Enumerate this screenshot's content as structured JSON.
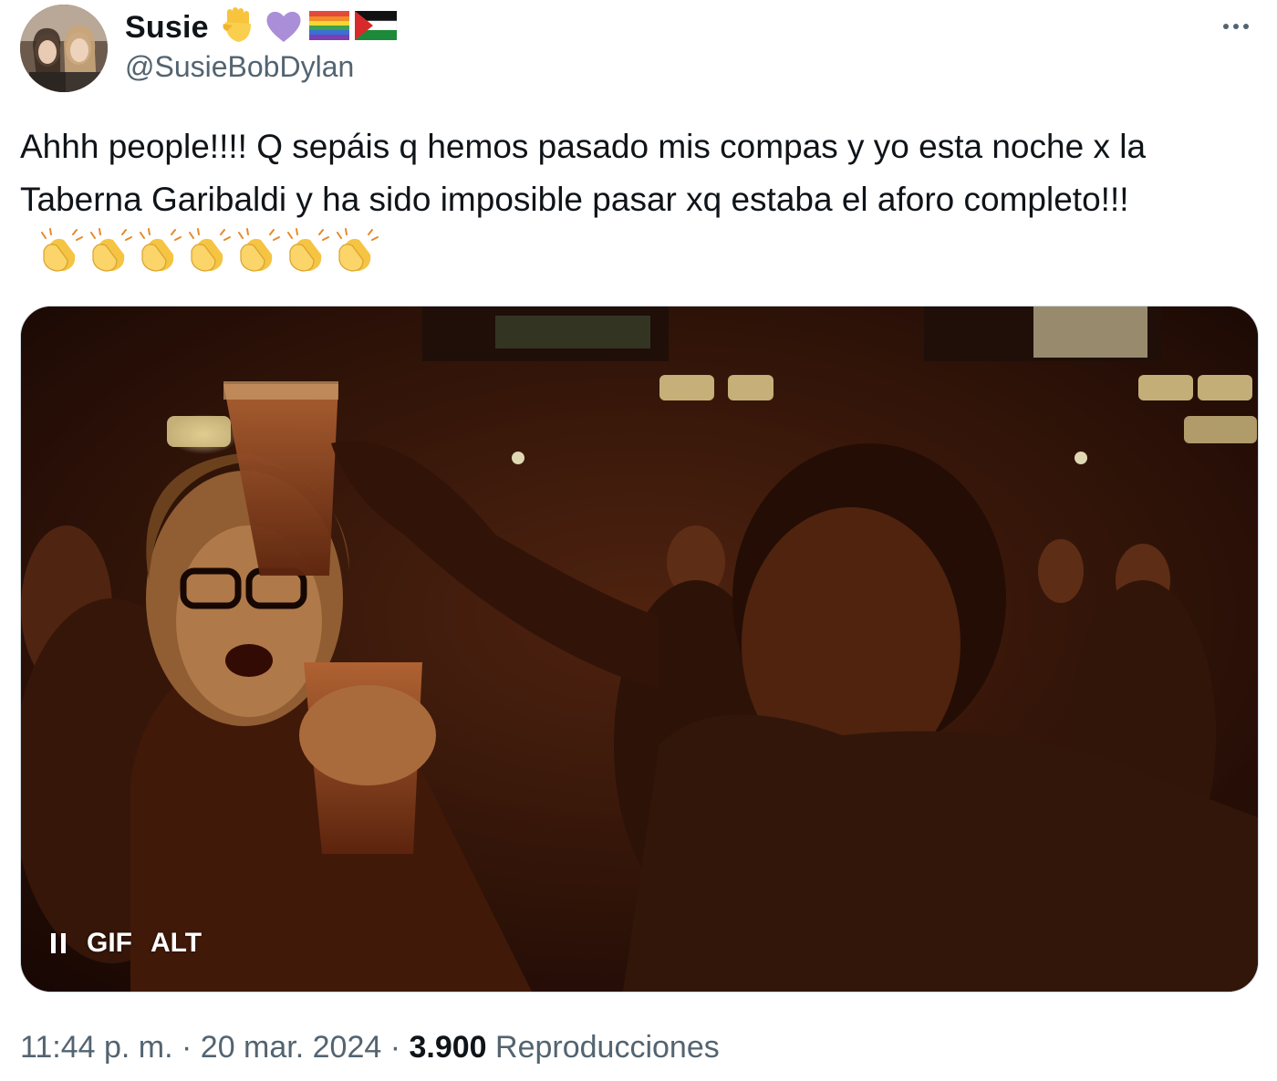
{
  "author": {
    "display_name": "Susie",
    "handle": "@SusieBobDylan",
    "name_emojis": [
      "raised-fist",
      "purple-heart",
      "rainbow-flag",
      "palestine-flag"
    ]
  },
  "tweet": {
    "text_main": "Ahhh people!!!!  Q sepáis q hemos pasado mis compas y yo esta noche x la Taberna Garibaldi y ha sido imposible pasar xq estaba el aforo completo!!!",
    "clap_emoji_count": 7
  },
  "media": {
    "badge_gif": "GIF",
    "badge_alt": "ALT",
    "pause_icon": "pause-icon"
  },
  "meta": {
    "time": "11:44 p. m.",
    "separator": " · ",
    "date": "20 mar. 2024",
    "views_count": "3.900",
    "views_label": "Reproducciones"
  },
  "colors": {
    "text_primary": "#0f1419",
    "text_secondary": "#536471",
    "border": "#cfd9de",
    "purple_heart": "#ab8ed8",
    "clap_yellow": "#f6c443"
  }
}
